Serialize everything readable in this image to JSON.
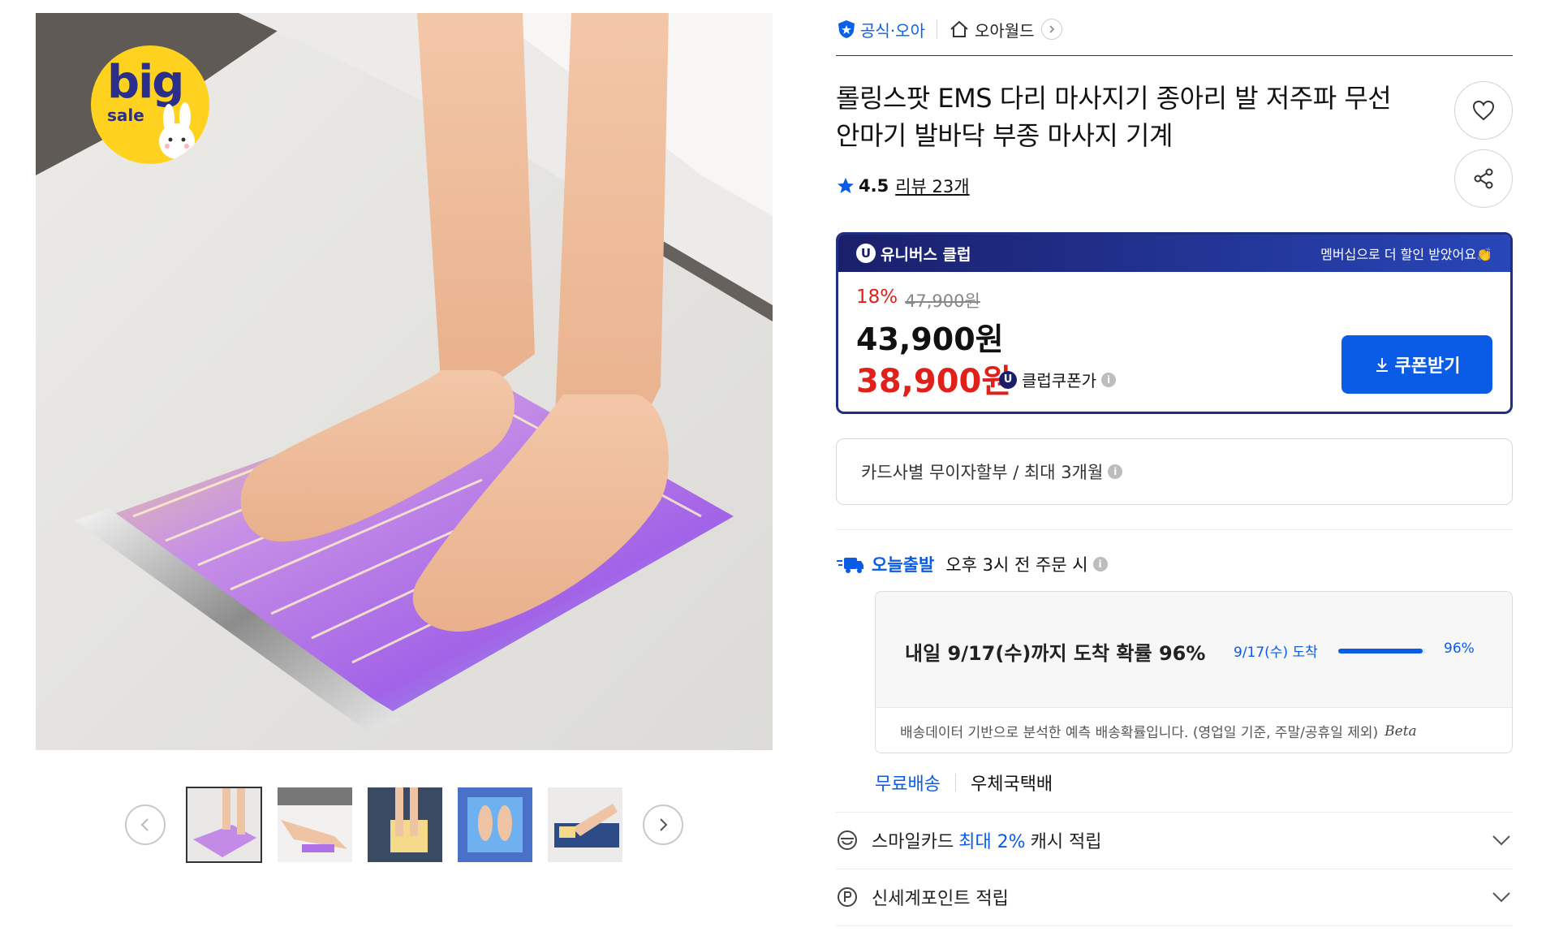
{
  "badge": {
    "big": "big",
    "sale": "sale"
  },
  "store": {
    "official_label": "공식",
    "brand_link": "·오아",
    "world_link": "오아월드"
  },
  "product": {
    "title": "롤링스팟 EMS 다리 마사지기 종아리 발 저주파 무선 안마기 발바닥 부종 마사지 기계",
    "rating": "4.5",
    "review_text": "리뷰 23개"
  },
  "club": {
    "name": "유니버스 클럽",
    "promo": "멤버십으로 더 할인 받았어요👏",
    "discount_rate": "18%",
    "original_price": "47,900원",
    "sale_price": "43,900원",
    "coupon_price": "38,900원",
    "coupon_price_label": "클럽쿠폰가",
    "coupon_button": "쿠폰받기"
  },
  "installment": {
    "text": "카드사별 무이자할부 / 최대 3개월"
  },
  "delivery": {
    "today_ship": "오늘출발",
    "cutoff": "오후 3시 전 주문 시",
    "headline": "내일 9/17(수)까지 도착 확률 96%",
    "date_label": "9/17(수) 도착",
    "probability_pct": "96%",
    "probability_value": 0.96,
    "note": "배송데이터 기반으로 분석한 예측 배송확률입니다. (영업일 기준, 주말/공휴일 제외)",
    "beta": "Beta",
    "free_shipping": "무료배송",
    "carrier": "우체국택배"
  },
  "benefits": [
    {
      "prefix": "스마일카드",
      "highlight": "최대 2%",
      "suffix": "캐시 적립",
      "icon": "smile-card-icon"
    },
    {
      "prefix": "신세계포인트 적립",
      "highlight": "",
      "suffix": "",
      "icon": "point-p-icon"
    }
  ],
  "thumbnails": [
    {
      "name": "thumb-foot-pad",
      "selected": true
    },
    {
      "name": "thumb-leg-massage",
      "selected": false
    },
    {
      "name": "thumb-feet-on-pad",
      "selected": false
    },
    {
      "name": "thumb-pad-blue-light",
      "selected": false
    },
    {
      "name": "thumb-lying-user",
      "selected": false
    }
  ],
  "colors": {
    "accent_blue": "#0a5be6",
    "club_navy": "#1f2f82",
    "sale_red": "#e0201b",
    "badge_yellow": "#ffd21f"
  }
}
